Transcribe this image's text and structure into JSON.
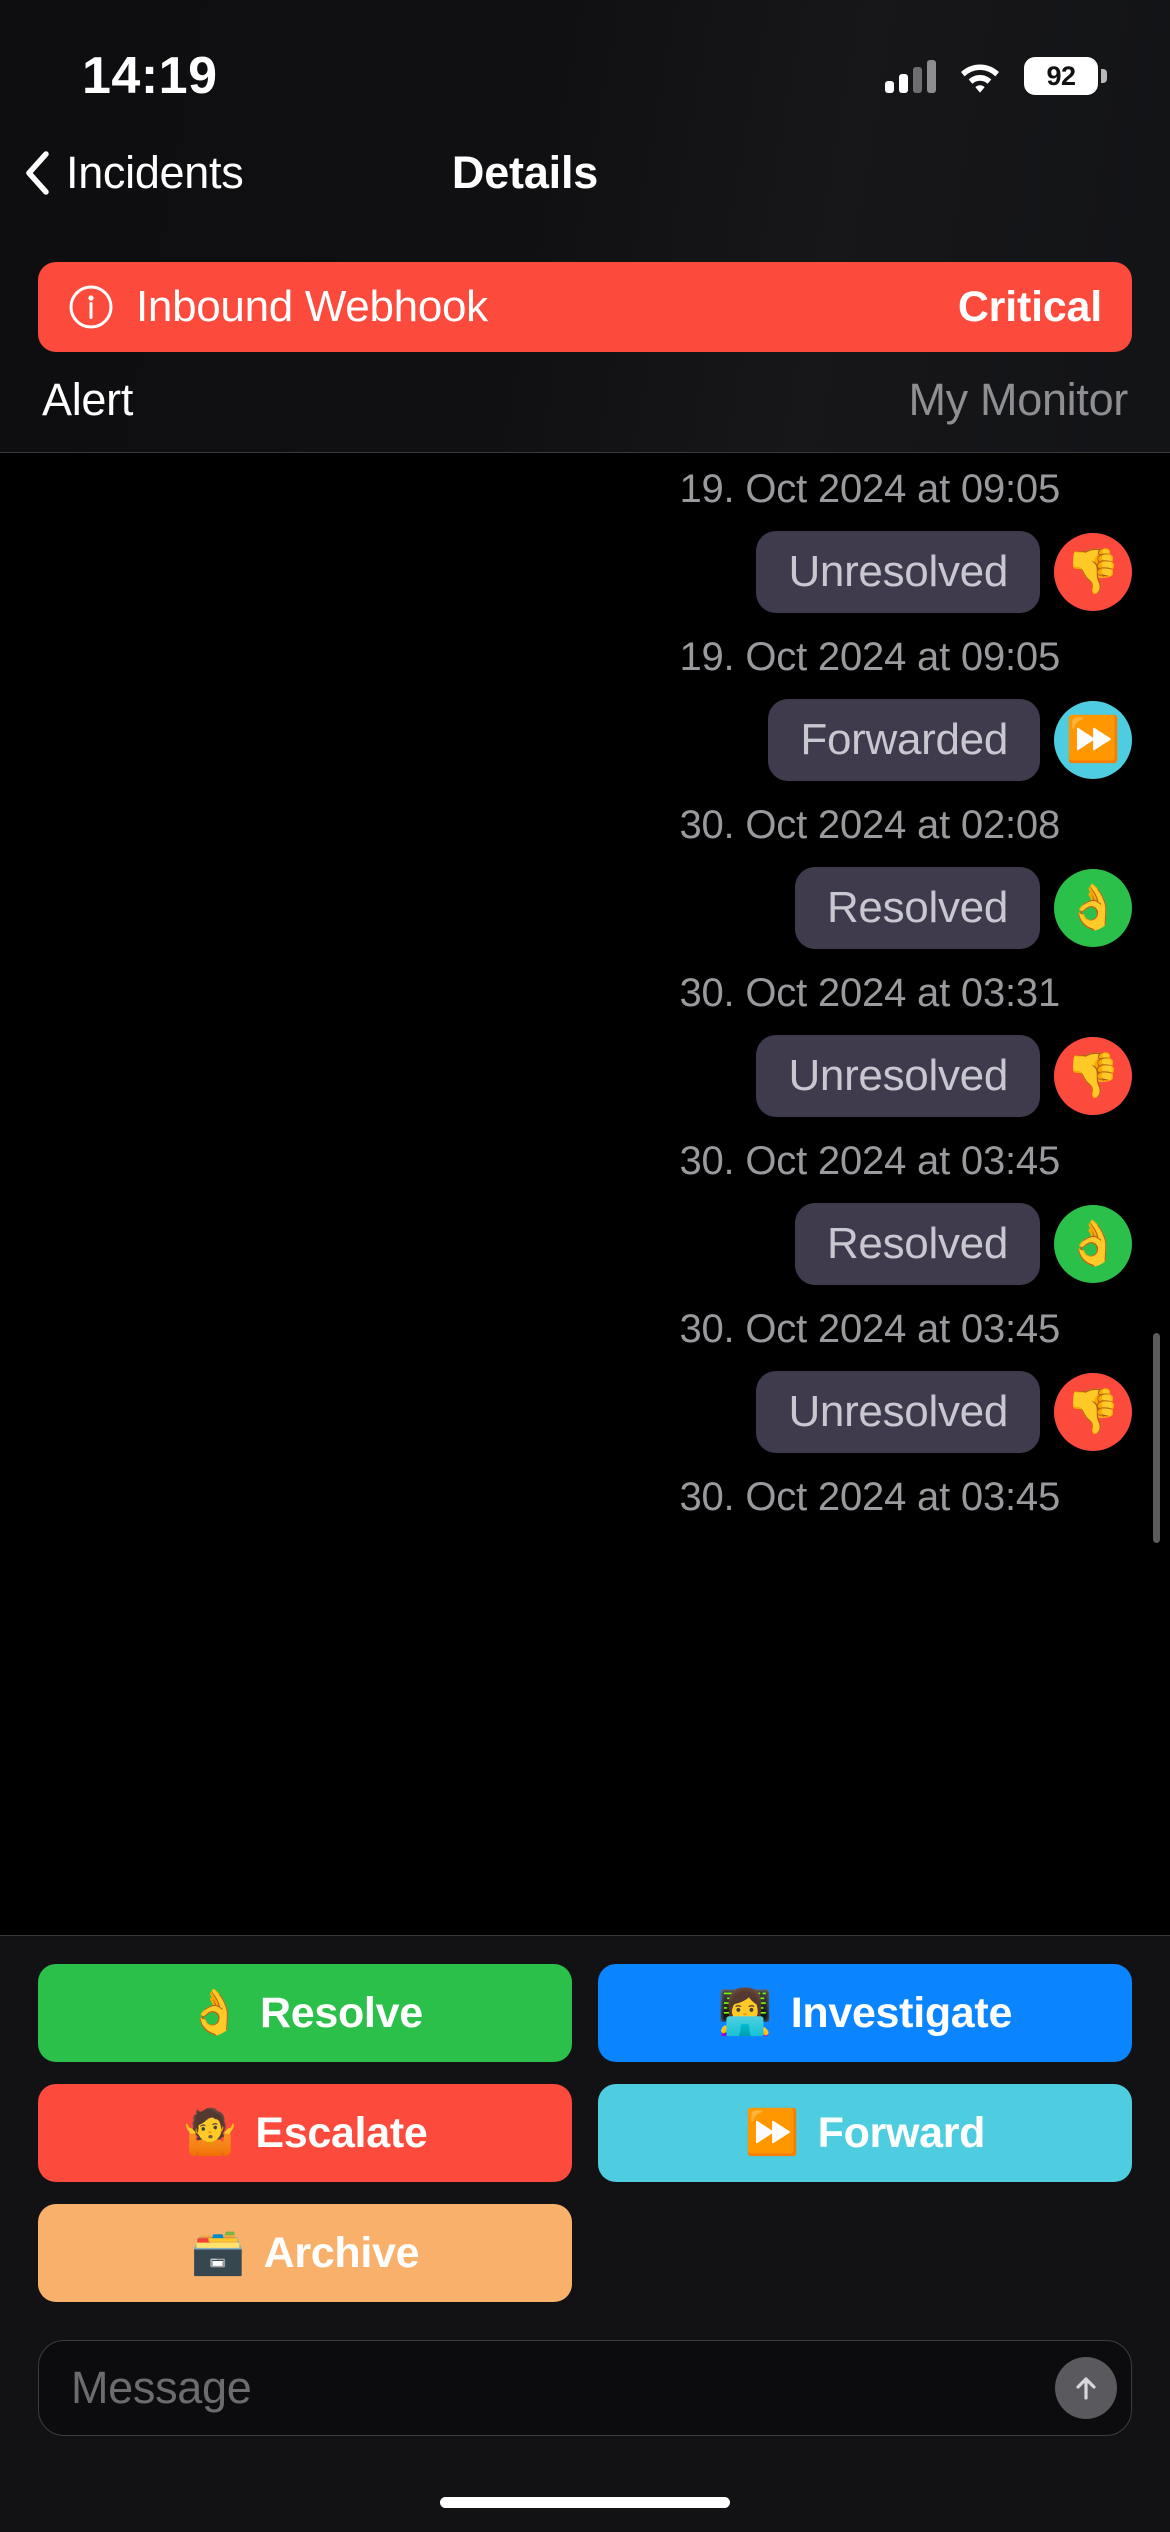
{
  "status_bar": {
    "time": "14:19",
    "battery_level": "92",
    "signal_icon": "cellular-bars-icon",
    "wifi_icon": "wifi-icon",
    "battery_icon": "battery-icon"
  },
  "nav": {
    "back_label": "Incidents",
    "back_icon": "chevron-left-icon",
    "title": "Details"
  },
  "alert_banner": {
    "icon": "info-circle-icon",
    "title": "Inbound Webhook",
    "severity": "Critical",
    "color": "#fc4a3c"
  },
  "sub_row": {
    "left": "Alert",
    "right": "My Monitor"
  },
  "timeline": {
    "entries": [
      {
        "time": "19. Oct 2024 at 09:05",
        "status": "",
        "emoji": "",
        "avatar_color": "",
        "has_bubble": false
      },
      {
        "time": "19. Oct 2024 at 09:05",
        "status": "Unresolved",
        "emoji": "👎",
        "emoji_name": "thumbs-down-icon",
        "avatar_color": "#fc4a3c",
        "has_bubble": true
      },
      {
        "time": "30. Oct 2024 at 02:08",
        "status": "Forwarded",
        "emoji": "⏩",
        "emoji_name": "fast-forward-icon",
        "avatar_color": "#4ecde0",
        "has_bubble": true
      },
      {
        "time": "30. Oct 2024 at 03:31",
        "status": "Resolved",
        "emoji": "👌",
        "emoji_name": "ok-hand-icon",
        "avatar_color": "#2ac049",
        "has_bubble": true
      },
      {
        "time": "30. Oct 2024 at 03:45",
        "status": "Unresolved",
        "emoji": "👎",
        "emoji_name": "thumbs-down-icon",
        "avatar_color": "#fc4a3c",
        "has_bubble": true
      },
      {
        "time": "30. Oct 2024 at 03:45",
        "status": "Resolved",
        "emoji": "👌",
        "emoji_name": "ok-hand-icon",
        "avatar_color": "#2ac049",
        "has_bubble": true
      },
      {
        "time": "30. Oct 2024 at 03:45",
        "status": "Unresolved",
        "emoji": "👎",
        "emoji_name": "thumbs-down-icon",
        "avatar_color": "#fc4a3c",
        "has_bubble": true
      }
    ]
  },
  "actions": [
    {
      "label": "Resolve",
      "emoji": "👌",
      "emoji_name": "ok-hand-icon",
      "color": "#2ac049"
    },
    {
      "label": "Investigate",
      "emoji": "👩‍💻",
      "emoji_name": "woman-technologist-icon",
      "color": "#0a84ff"
    },
    {
      "label": "Escalate",
      "emoji": "🤷",
      "emoji_name": "shrug-icon",
      "color": "#fc4a3c"
    },
    {
      "label": "Forward",
      "emoji": "⏩",
      "emoji_name": "fast-forward-icon",
      "color": "#4ecde0"
    },
    {
      "label": "Archive",
      "emoji": "🗃️",
      "emoji_name": "card-file-box-icon",
      "color": "#f9b06a"
    }
  ],
  "composer": {
    "placeholder": "Message",
    "value": "",
    "send_icon": "arrow-up-icon"
  }
}
